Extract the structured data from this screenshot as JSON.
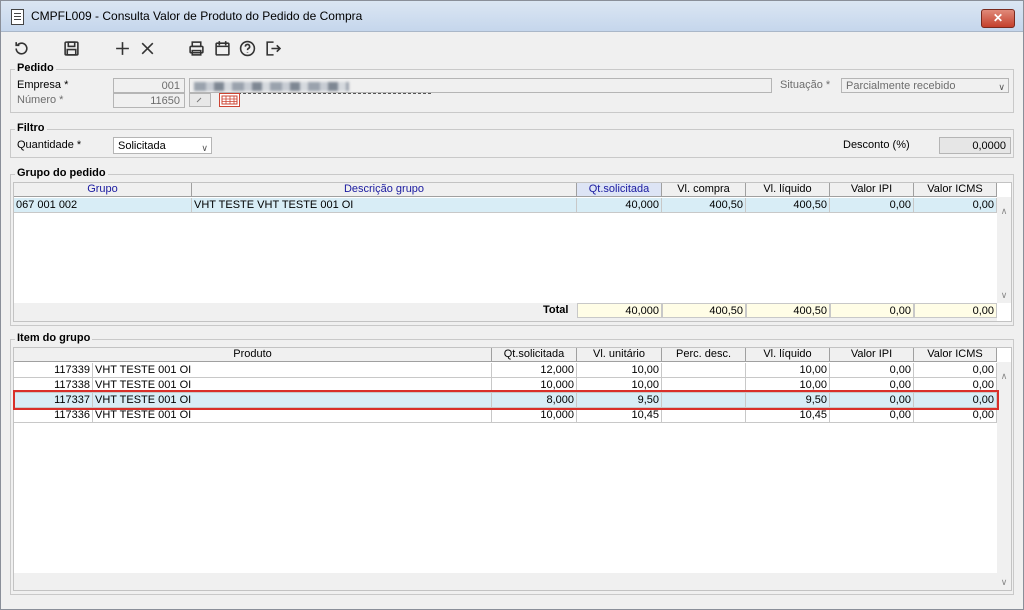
{
  "window": {
    "title": "CMPFL009 - Consulta Valor de Produto do Pedido de Compra",
    "close_label": "✕"
  },
  "toolbar": {
    "icons": [
      "refresh-icon",
      "save-icon",
      "add-icon",
      "cancel-icon",
      "print-icon",
      "calendar-icon",
      "help-icon",
      "exit-icon"
    ]
  },
  "pedido": {
    "section_title": "Pedido",
    "empresa_label": "Empresa *",
    "empresa_code": "001",
    "numero_label": "Número *",
    "numero_value": "11650",
    "situacao_label": "Situação *",
    "situacao_value": "Parcialmente recebido"
  },
  "filtro": {
    "section_title": "Filtro",
    "quantidade_label": "Quantidade *",
    "quantidade_value": "Solicitada",
    "desconto_label": "Desconto (%)",
    "desconto_value": "0,0000"
  },
  "grupo": {
    "section_title": "Grupo do pedido",
    "columns": [
      "Grupo",
      "Descrição grupo",
      "Qt.solicitada",
      "Vl. compra",
      "Vl. líquido",
      "Valor IPI",
      "Valor ICMS"
    ],
    "rows": [
      [
        "067 001 002",
        "VHT TESTE VHT TESTE 001 OI",
        "40,000",
        "400,50",
        "400,50",
        "0,00",
        "0,00"
      ]
    ],
    "total_label": "Total",
    "totals": [
      "40,000",
      "400,50",
      "400,50",
      "0,00",
      "0,00"
    ]
  },
  "item": {
    "section_title": "Item do grupo",
    "columns": [
      "Produto",
      "Qt.solicitada",
      "Vl. unitário",
      "Perc. desc.",
      "Vl. líquido",
      "Valor IPI",
      "Valor ICMS"
    ],
    "rows": [
      [
        "117339",
        "VHT TESTE 001 OI",
        "12,000",
        "10,00",
        "",
        "10,00",
        "0,00",
        "0,00"
      ],
      [
        "117338",
        "VHT TESTE 001 OI",
        "10,000",
        "10,00",
        "",
        "10,00",
        "0,00",
        "0,00"
      ],
      [
        "117337",
        "VHT TESTE 001 OI",
        "8,000",
        "9,50",
        "",
        "9,50",
        "0,00",
        "0,00"
      ],
      [
        "117336",
        "VHT TESTE 001 OI",
        "10,000",
        "10,45",
        "",
        "10,45",
        "0,00",
        "0,00"
      ]
    ]
  },
  "colors": {
    "highlight": "#d9302a",
    "selected_row": "#d8edf6",
    "total_bg": "#fffde6"
  }
}
